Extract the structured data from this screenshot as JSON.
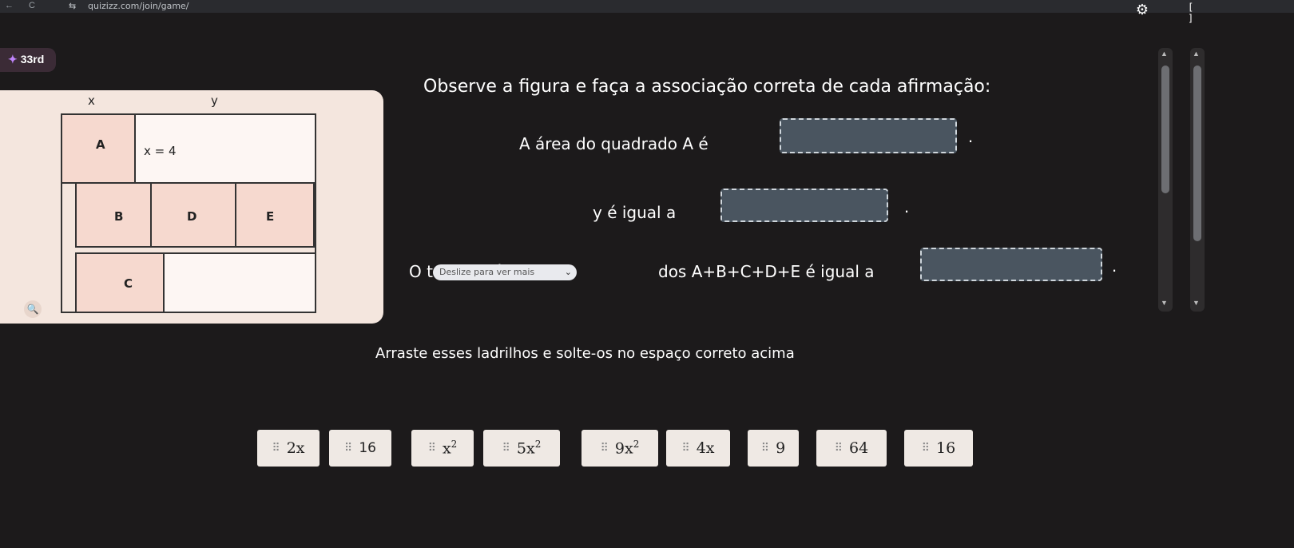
{
  "browser": {
    "back": "←",
    "reload": "C",
    "site_icon": "⇆",
    "url": "quizizz.com/join/game/",
    "settings_icon": "gear-icon",
    "fullscreen_icon": "fullscreen-icon"
  },
  "rank": {
    "label": "33rd"
  },
  "figure": {
    "x_label": "x",
    "y_label": "y",
    "cells": [
      {
        "label": "A",
        "value": "x = 4"
      },
      {
        "label": "B"
      },
      {
        "label": "D"
      },
      {
        "label": "E"
      },
      {
        "label": "C"
      }
    ]
  },
  "question": {
    "title": "Observe a figura e faça a associação correta de cada afirmação:",
    "statements": [
      {
        "text": "A área do quadrado A é",
        "end": "."
      },
      {
        "text": "y é igual a",
        "end": "."
      },
      {
        "prefix": "O total da á",
        "suffix": "dos A+B+C+D+E é igual a",
        "end": "."
      }
    ],
    "tooltip": "Deslize para ver mais"
  },
  "instruction": "Arraste esses ladrilhos e solte-os no espaço correto acima",
  "tiles": [
    {
      "base": "2x",
      "sup": "",
      "font": "serif"
    },
    {
      "base": "16",
      "sup": "",
      "font": "sans"
    },
    {
      "base": "x",
      "sup": "2",
      "font": "serif"
    },
    {
      "base": "5x",
      "sup": "2",
      "font": "serif"
    },
    {
      "base": "9x",
      "sup": "2",
      "font": "serif"
    },
    {
      "base": "4x",
      "sup": "",
      "font": "serif"
    },
    {
      "base": "9",
      "sup": "",
      "font": "serif"
    },
    {
      "base": "64",
      "sup": "",
      "font": "serif"
    },
    {
      "base": "16",
      "sup": "",
      "font": "serif"
    }
  ],
  "grip_symbol": "⠿",
  "colors": {
    "card": "#f4e6de",
    "cell_fill": "#f6d9cf",
    "drop_zone": "#4a5560",
    "tile": "#efe9e4",
    "background": "#1c1a1b"
  }
}
